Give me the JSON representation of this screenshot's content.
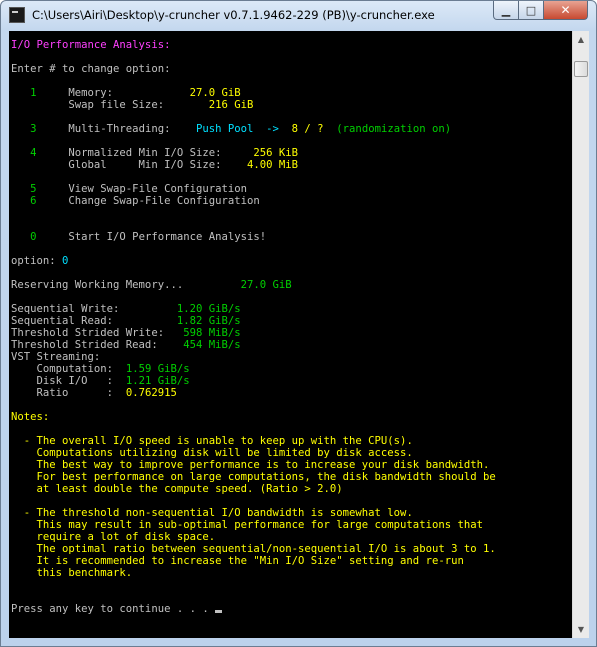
{
  "window": {
    "title": "C:\\Users\\Airi\\Desktop\\y-cruncher v0.7.1.9462-229 (PB)\\y-cruncher.exe",
    "controls": {
      "minimize": "▁",
      "maximize": "□",
      "close": "✕"
    }
  },
  "console": {
    "lines": [
      [
        {
          "t": "I/O Performance Analysis:",
          "c": "mag"
        }
      ],
      [],
      [
        {
          "t": "Enter # to change option:",
          "c": "gry"
        }
      ],
      [],
      [
        {
          "t": "   1",
          "c": "grn"
        },
        {
          "t": "     Memory:            ",
          "c": "gry"
        },
        {
          "t": "27.0 GiB",
          "c": "yel"
        }
      ],
      [
        {
          "t": "         Swap file Size:       ",
          "c": "gry"
        },
        {
          "t": "216 GiB",
          "c": "yel"
        }
      ],
      [],
      [
        {
          "t": "   3",
          "c": "grn"
        },
        {
          "t": "     Multi-Threading:    ",
          "c": "gry"
        },
        {
          "t": "Push Pool  ->",
          "c": "cyn"
        },
        {
          "t": "  8 / ?",
          "c": "yel"
        },
        {
          "t": "  (randomization on)",
          "c": "grn"
        }
      ],
      [],
      [
        {
          "t": "   4",
          "c": "grn"
        },
        {
          "t": "     Normalized Min I/O Size:     ",
          "c": "gry"
        },
        {
          "t": "256 KiB",
          "c": "yel"
        }
      ],
      [
        {
          "t": "         Global     Min I/O Size:    ",
          "c": "gry"
        },
        {
          "t": "4.00 MiB",
          "c": "yel"
        }
      ],
      [],
      [
        {
          "t": "   5",
          "c": "grn"
        },
        {
          "t": "     View Swap-File Configuration",
          "c": "gry"
        }
      ],
      [
        {
          "t": "   6",
          "c": "grn"
        },
        {
          "t": "     Change Swap-File Configuration",
          "c": "gry"
        }
      ],
      [],
      [],
      [
        {
          "t": "   0",
          "c": "grn"
        },
        {
          "t": "     Start I/O Performance Analysis!",
          "c": "gry"
        }
      ],
      [],
      [
        {
          "t": "option: ",
          "c": "gry"
        },
        {
          "t": "0",
          "c": "cyn"
        }
      ],
      [],
      [
        {
          "t": "Reserving Working Memory...         ",
          "c": "gry"
        },
        {
          "t": "27.0 GiB",
          "c": "grn"
        }
      ],
      [],
      [
        {
          "t": "Sequential Write:         ",
          "c": "gry"
        },
        {
          "t": "1.20 GiB/s",
          "c": "grn"
        }
      ],
      [
        {
          "t": "Sequential Read:          ",
          "c": "gry"
        },
        {
          "t": "1.82 GiB/s",
          "c": "grn"
        }
      ],
      [
        {
          "t": "Threshold Strided Write:   ",
          "c": "gry"
        },
        {
          "t": "598 MiB/s",
          "c": "grn"
        }
      ],
      [
        {
          "t": "Threshold Strided Read:    ",
          "c": "gry"
        },
        {
          "t": "454 MiB/s",
          "c": "grn"
        }
      ],
      [
        {
          "t": "VST Streaming:",
          "c": "gry"
        }
      ],
      [
        {
          "t": "    Computation:  ",
          "c": "gry"
        },
        {
          "t": "1.59 GiB/s",
          "c": "grn"
        }
      ],
      [
        {
          "t": "    Disk I/O   :  ",
          "c": "gry"
        },
        {
          "t": "1.21 GiB/s",
          "c": "grn"
        }
      ],
      [
        {
          "t": "    Ratio      :  ",
          "c": "gry"
        },
        {
          "t": "0.762915",
          "c": "yel"
        }
      ],
      [],
      [
        {
          "t": "Notes:",
          "c": "yel"
        }
      ],
      [],
      [
        {
          "t": "  - ",
          "c": "yel"
        },
        {
          "t": "The overall I/O speed is unable to keep up with the CPU(s).",
          "c": "yel"
        }
      ],
      [
        {
          "t": "    Computations utilizing disk will be limited by disk access.",
          "c": "yel"
        }
      ],
      [
        {
          "t": "    The best way to improve performance is to increase your disk bandwidth.",
          "c": "yel"
        }
      ],
      [
        {
          "t": "    For best performance on large computations, the disk bandwidth should be",
          "c": "yel"
        }
      ],
      [
        {
          "t": "    at least double the compute speed. (Ratio > 2.0)",
          "c": "yel"
        }
      ],
      [],
      [
        {
          "t": "  - ",
          "c": "yel"
        },
        {
          "t": "The threshold non-sequential I/O bandwidth is somewhat low.",
          "c": "yel"
        }
      ],
      [
        {
          "t": "    This may result in sub-optimal performance for large computations that",
          "c": "yel"
        }
      ],
      [
        {
          "t": "    require a lot of disk space.",
          "c": "yel"
        }
      ],
      [
        {
          "t": "    The optimal ratio between sequential/non-sequential I/O is about 3 to 1.",
          "c": "yel"
        }
      ],
      [
        {
          "t": "    It is recommended to increase the \"Min I/O Size\" setting and re-run",
          "c": "yel"
        }
      ],
      [
        {
          "t": "    this benchmark.",
          "c": "yel"
        }
      ],
      [],
      [],
      [
        {
          "t": "Press any key to continue . . . ",
          "c": "gry"
        }
      ]
    ]
  },
  "colors": {
    "magenta": "#ff40ff",
    "green": "#00d000",
    "yellow": "#ffff00",
    "cyan": "#00e0ff",
    "gray": "#c0c0c0",
    "console_bg": "#000000"
  },
  "scrollbar": {
    "up_icon": "▲",
    "down_icon": "▼"
  }
}
